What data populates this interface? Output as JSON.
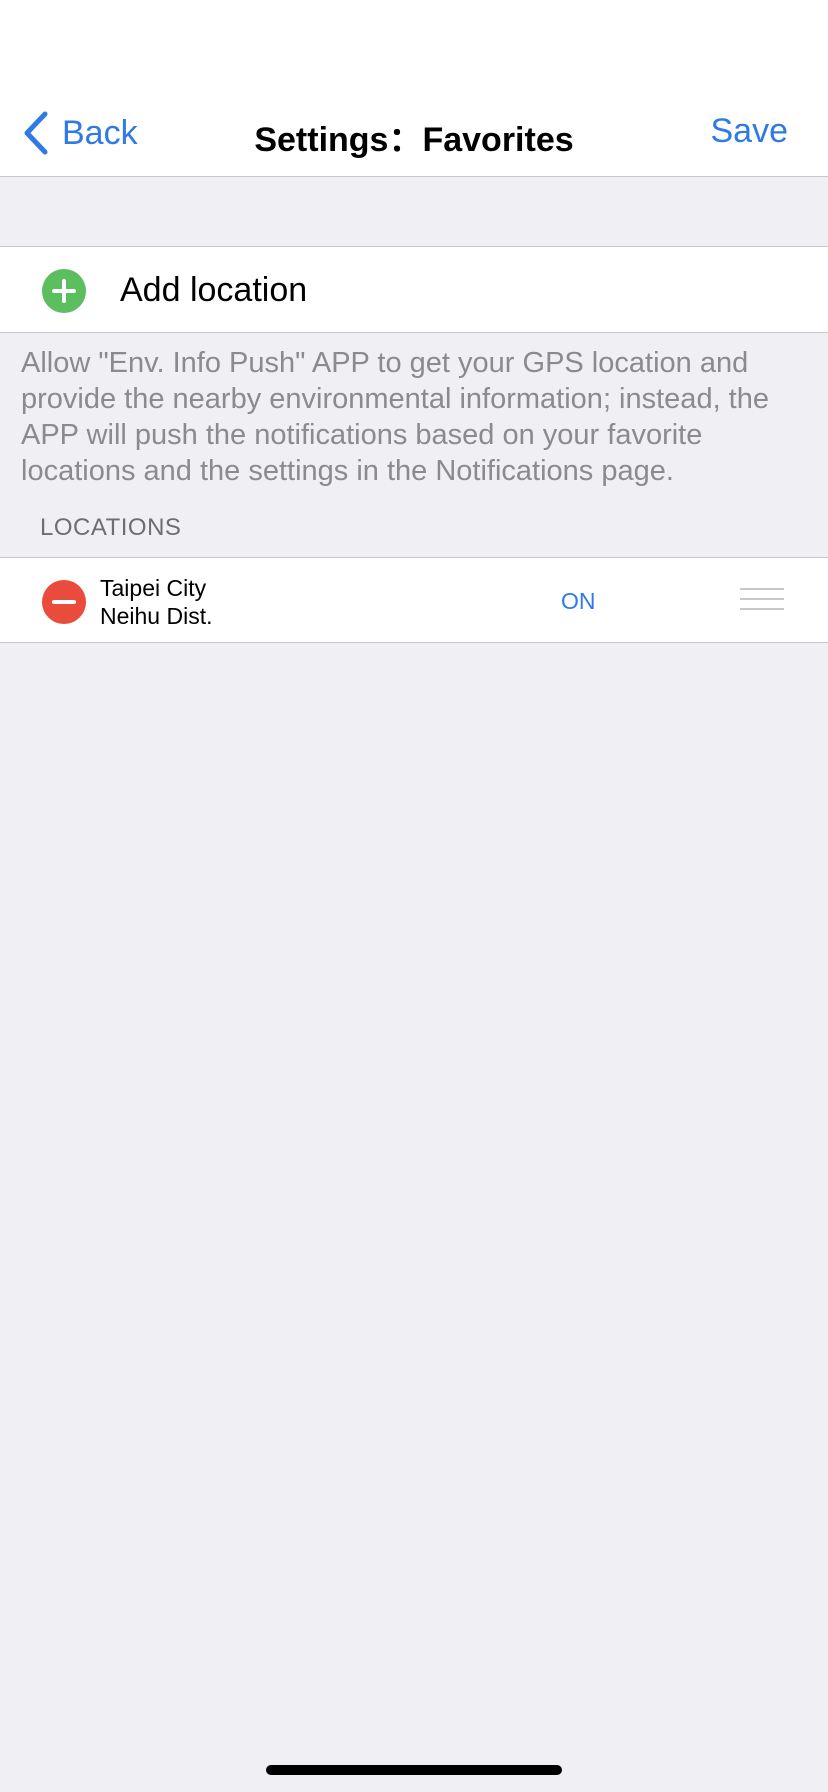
{
  "nav": {
    "back_label": "Back",
    "title": "Settings：Favorites",
    "save_label": "Save"
  },
  "add_location": {
    "label": "Add location",
    "icon": "plus-circle-icon"
  },
  "info_text": "Allow \"Env. Info Push\" APP to get your GPS location and provide the nearby environmental information; instead, the APP will push the notifications based on your favorite locations and the settings in the Notifications page.",
  "locations_header": "LOCATIONS",
  "locations": [
    {
      "city": "Taipei City",
      "district": "Neihu Dist.",
      "status": "ON"
    }
  ],
  "colors": {
    "accent": "#2f7ae5",
    "add": "#5cbf5f",
    "remove": "#e94b3c",
    "background": "#efeff4"
  }
}
